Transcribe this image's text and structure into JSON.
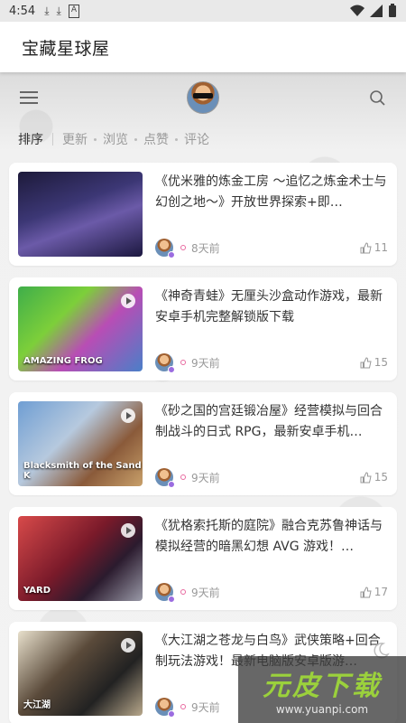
{
  "status": {
    "time": "4:54",
    "icons": [
      "download-icon",
      "download-icon",
      "a-icon"
    ],
    "right_icons": [
      "wifi-icon",
      "signal-icon",
      "battery-icon"
    ]
  },
  "app": {
    "title": "宝藏星球屋"
  },
  "nav": {
    "menu_icon": "menu-icon",
    "search_icon": "search-icon"
  },
  "sort": {
    "active": "排序",
    "options": [
      "更新",
      "浏览",
      "点赞",
      "评论"
    ]
  },
  "cards": [
    {
      "title": "《优米雅的炼金工房 ～追忆之炼金术士与幻创之地～》开放世界探索+即…",
      "time": "8天前",
      "likes": "11",
      "caption": ""
    },
    {
      "title": "《神奇青蛙》无厘头沙盒动作游戏，最新安卓手机完整解锁版下载",
      "time": "9天前",
      "likes": "15",
      "caption": "AMAZING FROG"
    },
    {
      "title": "《砂之国的宫廷锻冶屋》经营模拟与回合制战斗的日式 RPG，最新安卓手机…",
      "time": "9天前",
      "likes": "15",
      "caption": "Blacksmith of the Sand K"
    },
    {
      "title": "《犹格索托斯的庭院》融合克苏鲁神话与模拟经营的暗黑幻想 AVG 游戏！…",
      "time": "9天前",
      "likes": "17",
      "caption": "YARD"
    },
    {
      "title": "《大江湖之苍龙与白鸟》武侠策略+回合制玩法游戏！最新电脑版安卓版游…",
      "time": "9天前",
      "likes": "",
      "caption": "大江湖"
    }
  ],
  "watermark": {
    "cn": "元皮下载",
    "url": "www.yuanpi.com"
  },
  "colors": {
    "accent_dot": "#e86aa0",
    "badge": "#9b6ce0",
    "watermark_green": "#9bd13c"
  }
}
